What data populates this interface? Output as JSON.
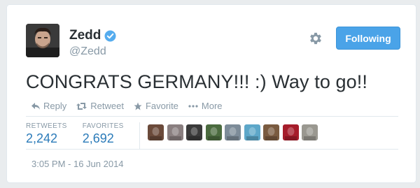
{
  "author": {
    "name": "Zedd",
    "handle": "@Zedd"
  },
  "follow_button": {
    "label": "Following"
  },
  "tweet": {
    "text": "CONGRATS GERMANY!!! :) Way to go!!"
  },
  "actions": [
    {
      "label": "Reply",
      "icon": "reply-icon"
    },
    {
      "label": "Retweet",
      "icon": "retweet-icon"
    },
    {
      "label": "Favorite",
      "icon": "star-icon"
    },
    {
      "label": "More",
      "icon": "more-dots-icon"
    }
  ],
  "stats": {
    "retweets_label": "RETWEETS",
    "retweets_value": "2,242",
    "favorites_label": "FAVORITES",
    "favorites_value": "2,692"
  },
  "favoriters": [
    {
      "color": "#6b4a3a"
    },
    {
      "color": "#8a7f80"
    },
    {
      "color": "#3a3a3a"
    },
    {
      "color": "#4b6b3f"
    },
    {
      "color": "#7d8c99"
    },
    {
      "color": "#5da7c9"
    },
    {
      "color": "#7a5b40"
    },
    {
      "color": "#a61d2b"
    },
    {
      "color": "#9a9890"
    }
  ],
  "timestamp": "3:05 PM - 16 Jun 2014",
  "colors": {
    "accent": "#4aa3e8",
    "link": "#2b7bb9",
    "muted": "#8899a6",
    "text": "#292f33"
  }
}
